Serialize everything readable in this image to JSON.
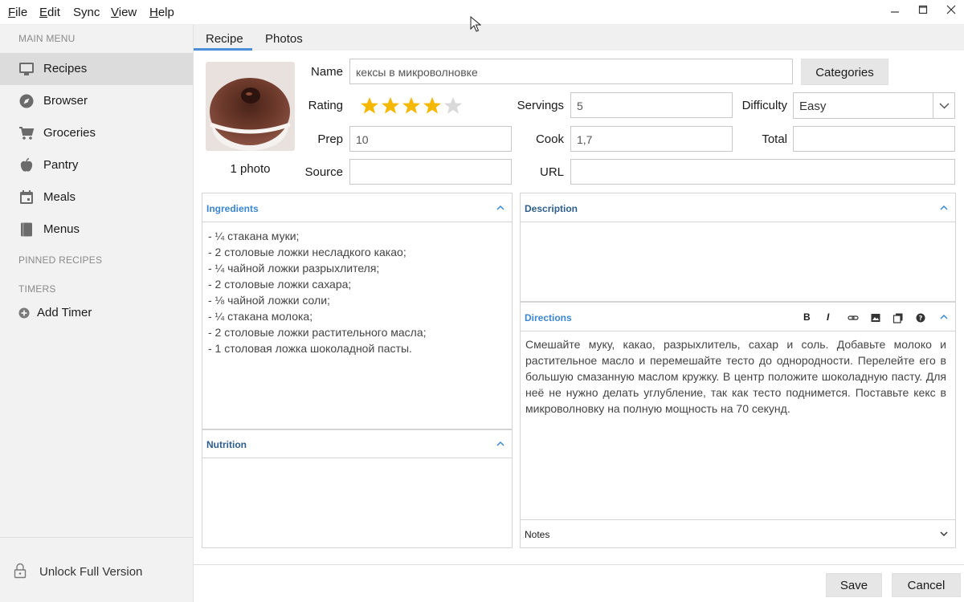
{
  "menubar": {
    "items": [
      {
        "label": "File",
        "underline": "F",
        "rest": "ile"
      },
      {
        "label": "Edit",
        "underline": "E",
        "rest": "dit"
      },
      {
        "label": "Sync",
        "underline": "",
        "rest": "Sync"
      },
      {
        "label": "View",
        "underline": "V",
        "rest": "iew"
      },
      {
        "label": "Help",
        "underline": "H",
        "rest": "elp"
      }
    ]
  },
  "sidebar": {
    "main_menu_heading": "MAIN MENU",
    "items": [
      {
        "label": "Recipes",
        "icon": "monitor-icon",
        "active": true
      },
      {
        "label": "Browser",
        "icon": "compass-icon",
        "active": false
      },
      {
        "label": "Groceries",
        "icon": "cart-icon",
        "active": false
      },
      {
        "label": "Pantry",
        "icon": "apple-icon",
        "active": false
      },
      {
        "label": "Meals",
        "icon": "calendar-icon",
        "active": false
      },
      {
        "label": "Menus",
        "icon": "book-icon",
        "active": false
      }
    ],
    "pinned_heading": "PINNED RECIPES",
    "timers_heading": "TIMERS",
    "add_timer_label": "Add Timer",
    "unlock_label": "Unlock Full Version"
  },
  "tabs": [
    {
      "label": "Recipe",
      "active": true
    },
    {
      "label": "Photos",
      "active": false
    }
  ],
  "recipe": {
    "photo_caption": "1 photo",
    "name_label": "Name",
    "name_value": "кексы в микроволновке",
    "categories_label": "Categories",
    "rating_label": "Rating",
    "rating_value": 4,
    "rating_max": 5,
    "servings_label": "Servings",
    "servings_value": "5",
    "difficulty_label": "Difficulty",
    "difficulty_value": "Easy",
    "prep_label": "Prep",
    "prep_value": "10",
    "cook_label": "Cook",
    "cook_value": "1,7",
    "total_label": "Total",
    "total_value": "",
    "source_label": "Source",
    "source_value": "",
    "url_label": "URL",
    "url_value": ""
  },
  "panels": {
    "ingredients_title": "Ingredients",
    "ingredients": [
      "- ¼ стакана муки;",
      "- 2 столовые ложки несладкого какао;",
      "- ¼ чайной ложки разрыхлителя;",
      "- 2 столовые ложки сахара;",
      "- ⅛ чайной ложки соли;",
      "- ¼ стакана молока;",
      "- 2 столовые ложки растительного масла;",
      "- 1 столовая ложка шоколадной пасты."
    ],
    "nutrition_title": "Nutrition",
    "description_title": "Description",
    "directions_title": "Directions",
    "directions_text": "Смешайте муку, какао, разрыхлитель, сахар и соль. Добавьте молоко и растительное масло и перемешайте тесто до однородности. Перелейте его в большую смазанную маслом кружку. В центр положите шоколадную пасту. Для неё не нужно делать углубление, так как тесто поднимется. Поставьте кекс в микроволновку на полную мощность на 70 секунд.",
    "notes_title": "Notes",
    "toolbar_bold": "B",
    "toolbar_italic": "I"
  },
  "footer": {
    "save_label": "Save",
    "cancel_label": "Cancel"
  },
  "colors": {
    "accent": "#3b86d1",
    "star": "#f5b800",
    "star_empty": "#d9d9d9",
    "sidebar_bg": "#f2f2f2",
    "sidebar_active": "#dcdcdc"
  }
}
